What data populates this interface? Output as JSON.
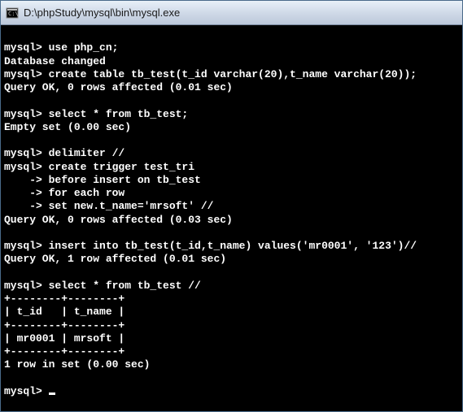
{
  "window": {
    "title": "D:\\phpStudy\\mysql\\bin\\mysql.exe"
  },
  "terminal": {
    "lines": [
      "",
      "mysql> use php_cn;",
      "Database changed",
      "mysql> create table tb_test(t_id varchar(20),t_name varchar(20));",
      "Query OK, 0 rows affected (0.01 sec)",
      "",
      "mysql> select * from tb_test;",
      "Empty set (0.00 sec)",
      "",
      "mysql> delimiter //",
      "mysql> create trigger test_tri",
      "    -> before insert on tb_test",
      "    -> for each row",
      "    -> set new.t_name='mrsoft' //",
      "Query OK, 0 rows affected (0.03 sec)",
      "",
      "mysql> insert into tb_test(t_id,t_name) values('mr0001', '123')//",
      "Query OK, 1 row affected (0.01 sec)",
      "",
      "mysql> select * from tb_test //",
      "+--------+--------+",
      "| t_id   | t_name |",
      "+--------+--------+",
      "| mr0001 | mrsoft |",
      "+--------+--------+",
      "1 row in set (0.00 sec)",
      "",
      "mysql> "
    ]
  }
}
